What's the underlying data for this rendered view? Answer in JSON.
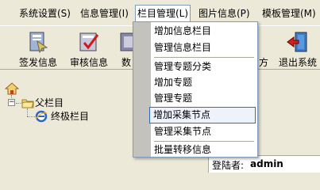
{
  "menubar": {
    "items": [
      {
        "label": "系统设置(S)"
      },
      {
        "label": "信息管理(I)"
      },
      {
        "label": "栏目管理(L)"
      },
      {
        "label": "图片信息(P)"
      },
      {
        "label": "模板管理(M)"
      }
    ]
  },
  "toolbar": {
    "buttons": [
      {
        "label": "签发信息",
        "icon": "publish-icon"
      },
      {
        "label": "审核信息",
        "icon": "audit-icon"
      },
      {
        "label": "数",
        "icon": "data-icon"
      },
      {
        "label": "方",
        "icon": "partial-icon"
      },
      {
        "label": "退出系统",
        "icon": "exit-icon"
      }
    ]
  },
  "dropdown": {
    "items": [
      {
        "label": "增加信息栏目"
      },
      {
        "label": "管理信息栏目"
      },
      {
        "label": "管理专题分类"
      },
      {
        "label": "增加专题"
      },
      {
        "label": "管理专题"
      },
      {
        "label": "增加采集节点"
      },
      {
        "label": "管理采集节点"
      },
      {
        "label": "批量转移信息"
      }
    ],
    "highlighted": "增加采集节点"
  },
  "tree": {
    "parent_label": "父栏目",
    "child_label": "终极栏目"
  },
  "status": {
    "login_label": "登陆者:",
    "login_user": "admin"
  },
  "colors": {
    "chrome": "#ece9d8",
    "highlight_border": "#316ac5",
    "gutter": "#c4c2bd"
  }
}
